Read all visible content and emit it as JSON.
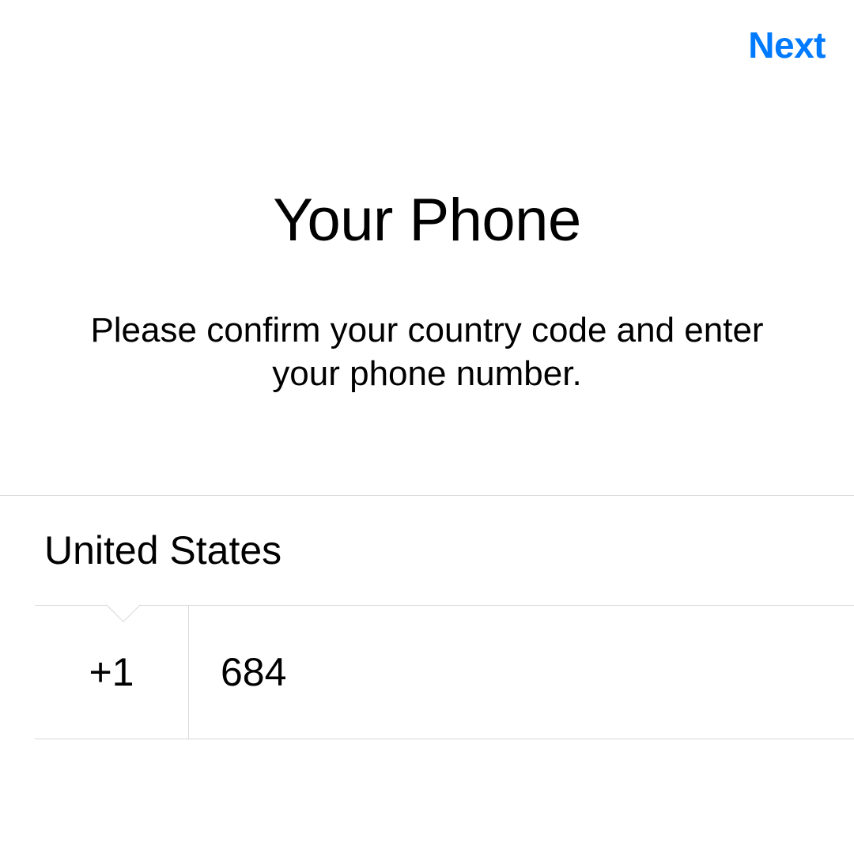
{
  "nav": {
    "next_label": "Next"
  },
  "header": {
    "title": "Your Phone",
    "subtitle": "Please confirm your country code and enter your phone number."
  },
  "form": {
    "country_name": "United States",
    "country_code": "+1",
    "phone_value": "684",
    "phone_placeholder": ""
  },
  "colors": {
    "accent": "#007aff",
    "divider": "#d8d8d8"
  }
}
